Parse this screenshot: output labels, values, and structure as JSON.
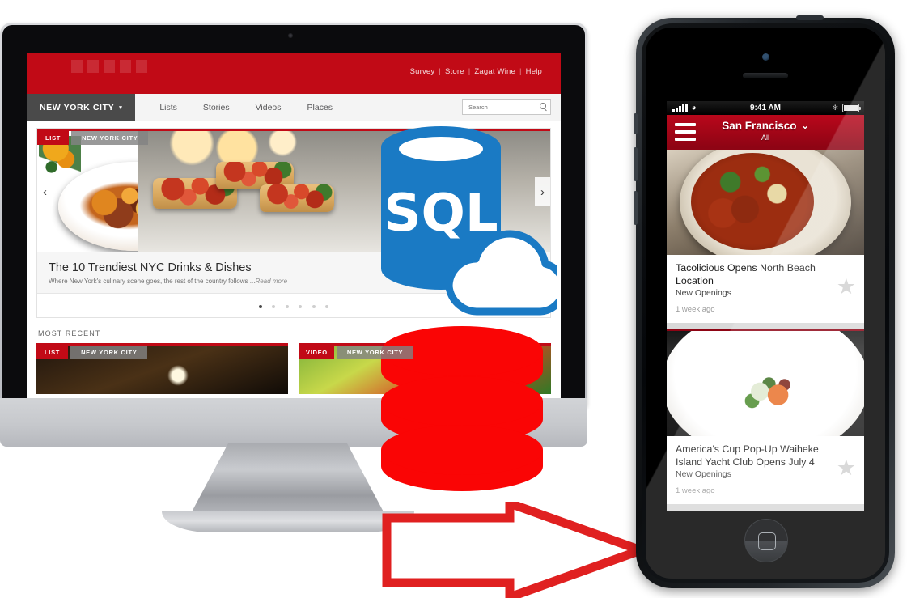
{
  "desktop": {
    "brand": "ZAGAT",
    "top_links": [
      "Survey",
      "Store",
      "Zagat Wine",
      "Help"
    ],
    "city_tab": "NEW YORK CITY",
    "city_caret": "▾",
    "nav": [
      "Lists",
      "Stories",
      "Videos",
      "Places"
    ],
    "search_placeholder": "Search",
    "search_value": "",
    "carousel": {
      "prev": "‹",
      "next": "›",
      "tag_list": "LIST",
      "tag_city": "NEW YORK CITY",
      "title": "The 10 Trendiest NYC Drinks & Dishes",
      "subtitle": "Where New York's culinary scene goes, the rest of the country follows ...",
      "read_more": "Read more",
      "dots": 6,
      "active_dot": 0
    },
    "most_recent_label": "MOST RECENT",
    "most_recent": [
      {
        "tag": "LIST",
        "city": "NEW YORK CITY"
      },
      {
        "tag": "VIDEO",
        "city": "NEW YORK CITY"
      }
    ]
  },
  "sql_logo": {
    "text": "SQL",
    "color": "#1a7ac4",
    "shape": "database-cloud"
  },
  "db_stack": {
    "color": "#fa0505",
    "disks": 3
  },
  "arrow": {
    "direction": "right",
    "stroke": "#e02020",
    "fill": "#ffffff"
  },
  "phone": {
    "status": {
      "time": "9:41 AM",
      "signal_bars": 5,
      "wifi": "wifi-icon",
      "bluetooth": "✻",
      "battery": "battery-icon"
    },
    "app_bar": {
      "menu": "hamburger-icon",
      "city": "San Francisco",
      "chevron": "⌄",
      "filter": "All"
    },
    "cards": [
      {
        "title": "Tacolicious Opens North Beach Location",
        "category": "New Openings",
        "time": "1 week ago",
        "favorite": "★",
        "image": "soup-bowl"
      },
      {
        "title": "America's Cup Pop-Up Waiheke Island Yacht Club Opens July 4",
        "category": "New Openings",
        "time": "1 week ago",
        "favorite": "★",
        "image": "plated-dish"
      }
    ]
  }
}
